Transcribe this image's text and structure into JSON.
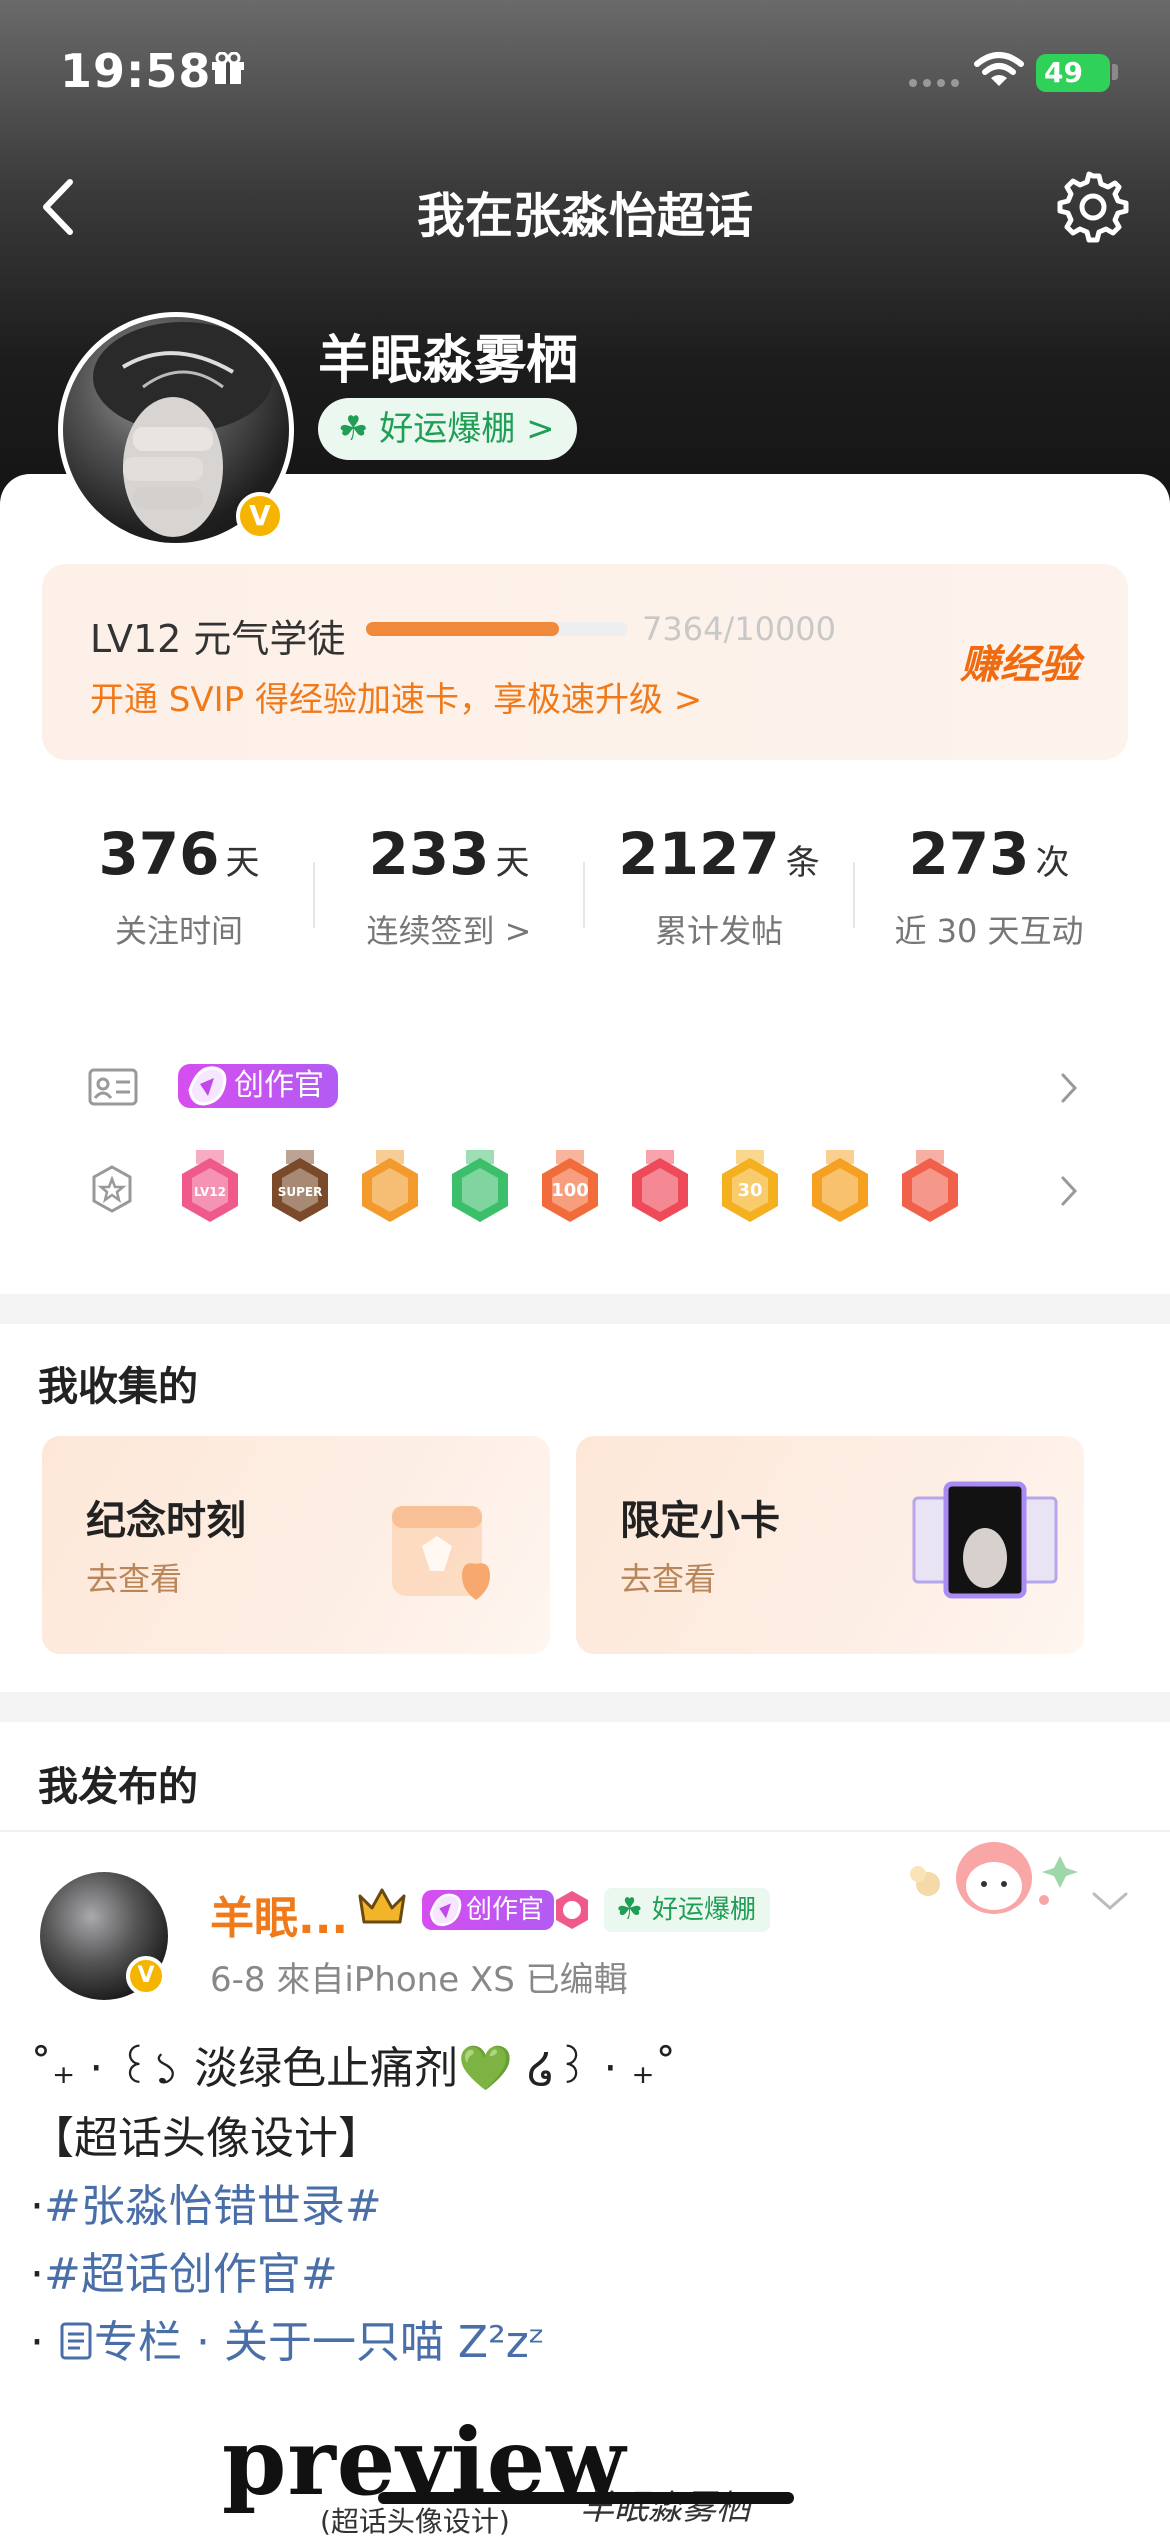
{
  "status_bar": {
    "time": "19:58",
    "battery": "49"
  },
  "header": {
    "title": "我在张淼怡超话"
  },
  "profile": {
    "username": "羊眠淼雾栖",
    "luck_badge": "好运爆棚 >",
    "verified_mark": "V"
  },
  "level": {
    "title": "LV12 元气学徒",
    "progress_text": "7364/10000",
    "progress_fraction": 0.7364,
    "promo": "开通 SVIP 得经验加速卡，享极速升级 >",
    "earn_label": "赚经验",
    "accent": "#f07a1a"
  },
  "stats": [
    {
      "value": "376",
      "unit": "天",
      "label": "关注时间"
    },
    {
      "value": "233",
      "unit": "天",
      "label": "连续签到 >"
    },
    {
      "value": "2127",
      "unit": "条",
      "label": "累计发帖"
    },
    {
      "value": "273",
      "unit": "次",
      "label": "近 30 天互动"
    }
  ],
  "badges": {
    "creator_label": "创作官",
    "medals": [
      {
        "icon": "lv12-medal-icon",
        "color": "#ef5a8a",
        "text": "LV12"
      },
      {
        "icon": "super-medal-icon",
        "color": "#7a4a2a",
        "text": "SUPER"
      },
      {
        "icon": "crown-medal-icon",
        "color": "#f29a2c",
        "text": ""
      },
      {
        "icon": "hand-medal-icon",
        "color": "#3cbf6a",
        "text": ""
      },
      {
        "icon": "100-days-medal-icon",
        "color": "#f26b3a",
        "text": "100"
      },
      {
        "icon": "trophy-medal-icon",
        "color": "#ef4a5a",
        "text": ""
      },
      {
        "icon": "30-days-medal-icon",
        "color": "#f5b020",
        "text": "30"
      },
      {
        "icon": "cheer-medal-icon",
        "color": "#f5a020",
        "text": ""
      },
      {
        "icon": "rock-hand-medal-icon",
        "color": "#f0604a",
        "text": ""
      }
    ]
  },
  "collected": {
    "section_title": "我收集的",
    "items": [
      {
        "title": "纪念时刻",
        "sub": "去查看"
      },
      {
        "title": "限定小卡",
        "sub": "去查看"
      }
    ]
  },
  "published": {
    "section_title": "我发布的",
    "post": {
      "author": "羊眠...",
      "creator_label": "创作官",
      "luck_label": "好运爆棚",
      "meta": "6-8  來自iPhone XS  已编輯",
      "line1": "˚₊ · ꒰১ 淡绿色止痛剂💚 ໒꒱ · ₊˚",
      "line2": "【超话头像设计】",
      "line3_prefix": "·",
      "line3_tag": "#张淼怡错世录#",
      "line4_prefix": "·",
      "line4_tag": "#超话创作官#",
      "line5_prefix": "·  ",
      "line5_tag": "专栏 · 关于一只喵 Z²zᶻ",
      "preview_word": "preview",
      "preview_sub": "(超话头像设计)",
      "preview_sign": "羊眠淼雾栖"
    }
  }
}
